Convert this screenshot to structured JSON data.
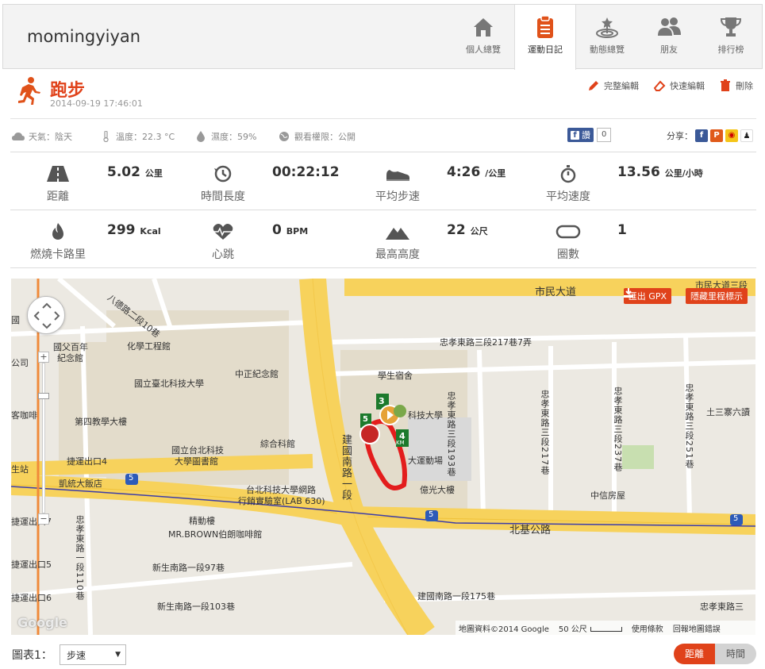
{
  "header": {
    "username": "momingyiyan",
    "nav": [
      {
        "label": "個人總覽",
        "icon": "home-icon"
      },
      {
        "label": "運動日記",
        "icon": "clipboard-icon",
        "active": true
      },
      {
        "label": "動態總覽",
        "icon": "target-icon"
      },
      {
        "label": "朋友",
        "icon": "friends-icon"
      },
      {
        "label": "排行榜",
        "icon": "trophy-icon"
      }
    ]
  },
  "activity": {
    "title": "跑步",
    "datetime": "2014-09-19 17:46:01",
    "actions": {
      "full_edit": "完整編輯",
      "quick_edit": "快速編輯",
      "delete": "刪除"
    }
  },
  "conditions": {
    "weather": "天氣：陰天",
    "temperature": "溫度：22.3 °C",
    "humidity": "濕度：59%",
    "privacy": "觀看權限：公開",
    "fb_like_label": "讚",
    "fb_like_count": "0",
    "share_label": "分享："
  },
  "stats": {
    "distance": {
      "label": "距離",
      "value": "5.02",
      "unit": "公里"
    },
    "duration": {
      "label": "時間長度",
      "value": "00:22:12",
      "unit": ""
    },
    "pace": {
      "label": "平均步速",
      "value": "4:26",
      "unit": "/公里"
    },
    "speed": {
      "label": "平均速度",
      "value": "13.56",
      "unit": "公里/小時"
    },
    "calories": {
      "label": "燃燒卡路里",
      "value": "299",
      "unit": "Kcal"
    },
    "heart_rate": {
      "label": "心跳",
      "value": "0",
      "unit": "BPM"
    },
    "altitude": {
      "label": "最高高度",
      "value": "22",
      "unit": "公尺"
    },
    "laps": {
      "label": "圈數",
      "value": "1",
      "unit": ""
    }
  },
  "map": {
    "export_gpx": "匯出 GPX",
    "hide_markers": "隱藏里程標示",
    "labels": {
      "l1": "市民大道",
      "l2": "忠孝東路三段217巷7弄",
      "l3": "國父百年",
      "l3b": "紀念館",
      "l4": "化學工程館",
      "l5": "國立臺北科技大學",
      "l6": "中正紀念館",
      "l7": "學生宿舍",
      "l8": "第四教學大樓",
      "l9": "國立台北科技",
      "l9b": "大學圖書館",
      "l10": "綜合科館",
      "l11": "捷運出口4",
      "l12": "凱統大飯店",
      "l13": "台北科技大學網路",
      "l13b": "行銷實驗室(LAB 630)",
      "l14": "億光大樓",
      "l15": "中信房屋",
      "l16": "精動樓",
      "l17": "MR.BROWN伯朗咖啡館",
      "l18": "北基公路",
      "l19": "新生南路一段97巷",
      "l20": "新生南路一段103巷",
      "l21": "建國南路一段175巷",
      "l22": "忠孝東路三",
      "l23": "土三寨六讀",
      "l24": "客咖啡",
      "l25": "生站",
      "l26": "捷運出口7",
      "l27": "捷運出口5",
      "l28": "捷運出口6",
      "l29": "科技大學",
      "l30": "大運動場",
      "l31": "市民大道三段",
      "l32": "公司",
      "l33": "國",
      "l34": "5",
      "l35": "5",
      "l36": "5",
      "v1": "建國南路一段",
      "v2": "忠孝東路三段193巷",
      "v3": "忠孝東路三段217巷",
      "v4": "忠孝東路三段237巷",
      "v5": "忠孝東路三段251巷",
      "v6": "忠孝東路一段110巷",
      "v7": "八德路二段10巷"
    },
    "markers": [
      "3",
      "5",
      "4"
    ],
    "km_label": "KM",
    "google": "Google",
    "footer": {
      "copyright": "地圖資料©2014 Google",
      "scale": "50 公尺",
      "terms": "使用條款",
      "report": "回報地圖錯誤"
    }
  },
  "chart": {
    "label": "圖表1：",
    "selected": "步速",
    "toggle_on": "距離",
    "toggle_off": "時間"
  }
}
